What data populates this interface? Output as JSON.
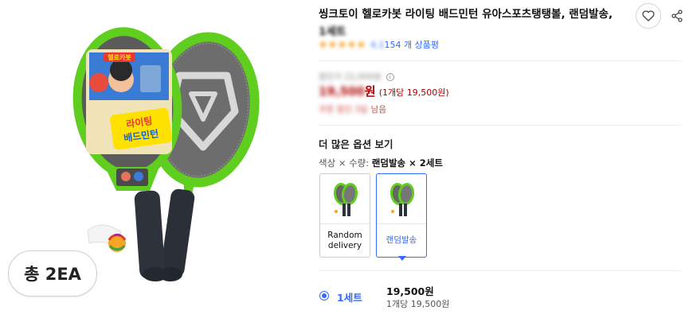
{
  "image": {
    "product_photo_alt": "헬로카봇 라이팅 배드민턴",
    "package_label": "라이팅 배드민턴",
    "brand_sticker": "헬로카봇",
    "count_badge": "총 2EA"
  },
  "product": {
    "title": "씽크토이 헬로카봇 라이팅 배드민턴 유아스포츠탱탱볼, 랜덤발송,",
    "title_overflow": "1세트",
    "rating_stars": 5,
    "review_count_visible": "154 개 상품평",
    "review_count_blurred": "4,1"
  },
  "price": {
    "original_price_blurred": "할인가 22,000원",
    "sale_price_blurred": "19,500",
    "sale_price_suffix": "원",
    "unit_price": "(1개당 19,500원)",
    "coupon_blurred": "쿠폰 할인 3일",
    "coupon_suffix": "남음"
  },
  "options": {
    "section_title": "더 많은 옵션 보기",
    "selected_prefix": "색상 × 수량: ",
    "selected_value": "랜덤발송 × 2세트",
    "cards": [
      {
        "label": "Random delivery",
        "selected": false
      },
      {
        "label": "랜덤발송",
        "selected": true
      }
    ]
  },
  "quantity": {
    "label": "1세트",
    "price": "19,500원",
    "unit_price": "1개당 19,500원"
  },
  "icons": {
    "favorite": "heart-icon",
    "share": "share-icon",
    "info": "info-icon"
  },
  "colors": {
    "accent_blue": "#346aff",
    "price_red": "#ae0000",
    "racket_green": "#5fce1f",
    "star_orange": "#f6a021"
  }
}
